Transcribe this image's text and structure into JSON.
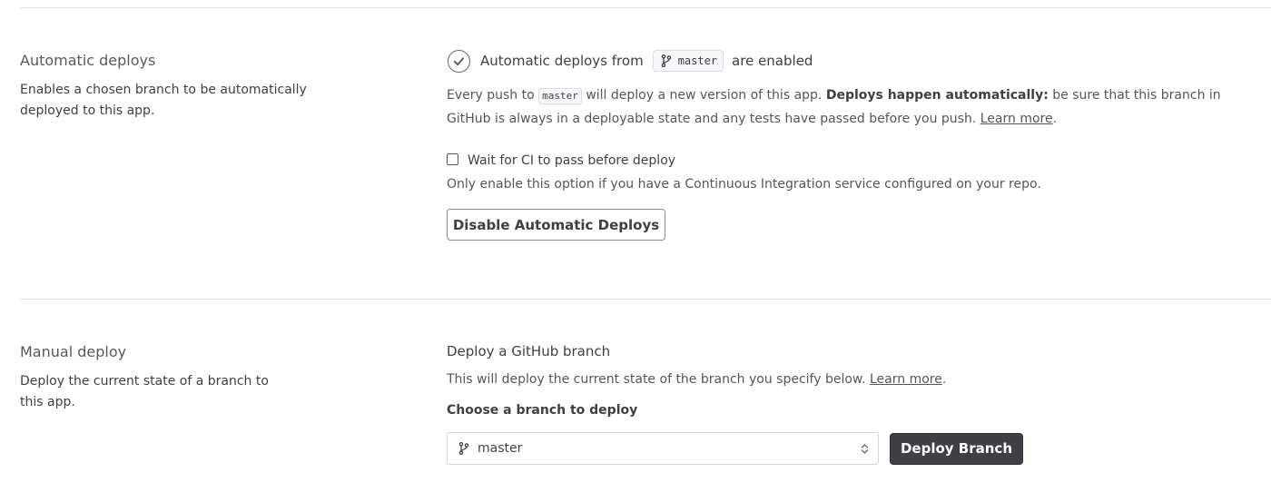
{
  "automatic": {
    "title": "Automatic deploys",
    "description": "Enables a chosen branch to be automatically deployed to this app.",
    "status_prefix": "Automatic deploys from",
    "branch": "master",
    "status_suffix": "are enabled",
    "para_prefix": "Every push to",
    "para_branch": "master",
    "para_mid": "will deploy a new version of this app.",
    "para_bold": "Deploys happen automatically:",
    "para_rest": "be sure that this branch in GitHub is always in a deployable state and any tests have passed before you push.",
    "learn_more": "Learn more",
    "ci_label": "Wait for CI to pass before deploy",
    "ci_checked": false,
    "ci_hint": "Only enable this option if you have a Continuous Integration service configured on your repo.",
    "disable_button": "Disable Automatic Deploys"
  },
  "manual": {
    "title": "Manual deploy",
    "description": "Deploy the current state of a branch to this app.",
    "heading": "Deploy a GitHub branch",
    "desc_prefix": "This will deploy the current state of the branch you specify below.",
    "learn_more": "Learn more",
    "choose_label": "Choose a branch to deploy",
    "selected_branch": "master",
    "deploy_button": "Deploy Branch"
  },
  "icons": {
    "status": "check-circle-icon",
    "branch": "git-branch-icon",
    "select": "select-caret-icon"
  },
  "colors": {
    "text": "#3f3f44",
    "muted": "#55555c",
    "dark_button": "#3f3f44"
  }
}
